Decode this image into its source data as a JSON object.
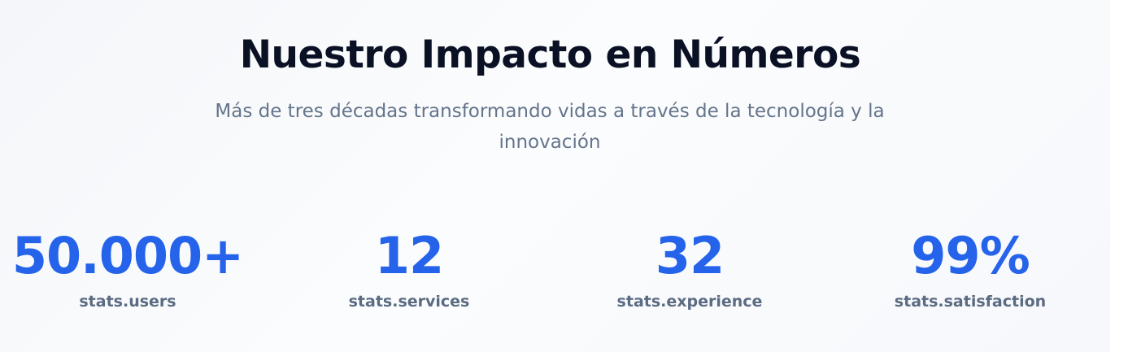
{
  "section": {
    "title": "Nuestro Impacto en Números",
    "subtitle": "Más de tres décadas transformando vidas a través de la tecnología y la innovación"
  },
  "stats": [
    {
      "value": "50.000+",
      "label": "stats.users"
    },
    {
      "value": "12",
      "label": "stats.services"
    },
    {
      "value": "32",
      "label": "stats.experience"
    },
    {
      "value": "99%",
      "label": "stats.satisfaction"
    }
  ],
  "colors": {
    "accent": "#2563eb",
    "heading": "#0b1124",
    "muted": "#64748b"
  }
}
